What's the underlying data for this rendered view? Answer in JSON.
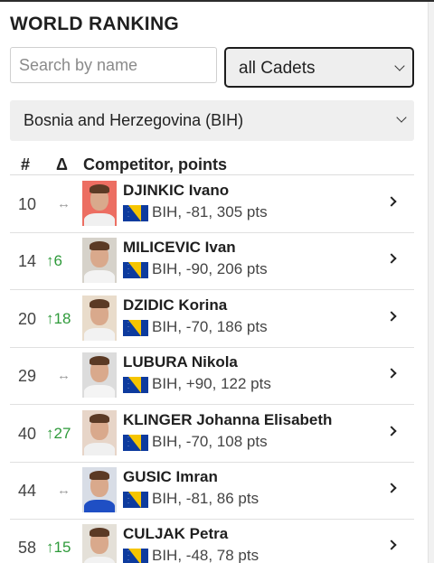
{
  "header": {
    "title": "WORLD RANKING"
  },
  "search": {
    "placeholder": "Search by name",
    "value": ""
  },
  "category_select": {
    "selected": "all Cadets"
  },
  "country_select": {
    "selected": "Bosnia and Herzegovina (BIH)"
  },
  "table": {
    "columns": {
      "rank": "#",
      "change": "Δ",
      "competitor": "Competitor, points"
    },
    "rows": [
      {
        "rank": "10",
        "change": "",
        "name": "DJINKIC Ivano",
        "meta": "BIH, -81, 305 pts",
        "photo_bg": "#ec6e62",
        "shirt": "#f0f0f0"
      },
      {
        "rank": "14",
        "change": "↑6",
        "name": "MILICEVIC Ivan",
        "meta": "BIH, -90, 206 pts",
        "photo_bg": "#d6d2ca",
        "shirt": "#f3f3f3"
      },
      {
        "rank": "20",
        "change": "↑18",
        "name": "DZIDIC Korina",
        "meta": "BIH, -70, 186 pts",
        "photo_bg": "#e9dccb",
        "shirt": "#f2f2f2"
      },
      {
        "rank": "29",
        "change": "",
        "name": "LUBURA Nikola",
        "meta": "BIH, +90, 122 pts",
        "photo_bg": "#dcdcdc",
        "shirt": "#f4f4f4"
      },
      {
        "rank": "40",
        "change": "↑27",
        "name": "KLINGER Johanna Elisabeth",
        "meta": "BIH, -70, 108 pts",
        "photo_bg": "#e7d5c8",
        "shirt": "#f0f0f0"
      },
      {
        "rank": "44",
        "change": "",
        "name": "GUSIC Imran",
        "meta": "BIH, -81, 86 pts",
        "photo_bg": "#d8dde6",
        "shirt": "#1f4fc4"
      },
      {
        "rank": "58",
        "change": "↑15",
        "name": "CULJAK Petra",
        "meta": "BIH, -48, 78 pts",
        "photo_bg": "#e4e0d8",
        "shirt": "#f2f2f2"
      }
    ]
  },
  "colors": {
    "positive_change": "#2e9a3a",
    "flag_blue": "#0d3b9e",
    "flag_yellow": "#f6c500"
  },
  "icons": {
    "no_change": "↔",
    "row_action": "chevron-right-icon",
    "dropdown": "chevron-down-icon",
    "flag": "bih-flag-icon"
  }
}
